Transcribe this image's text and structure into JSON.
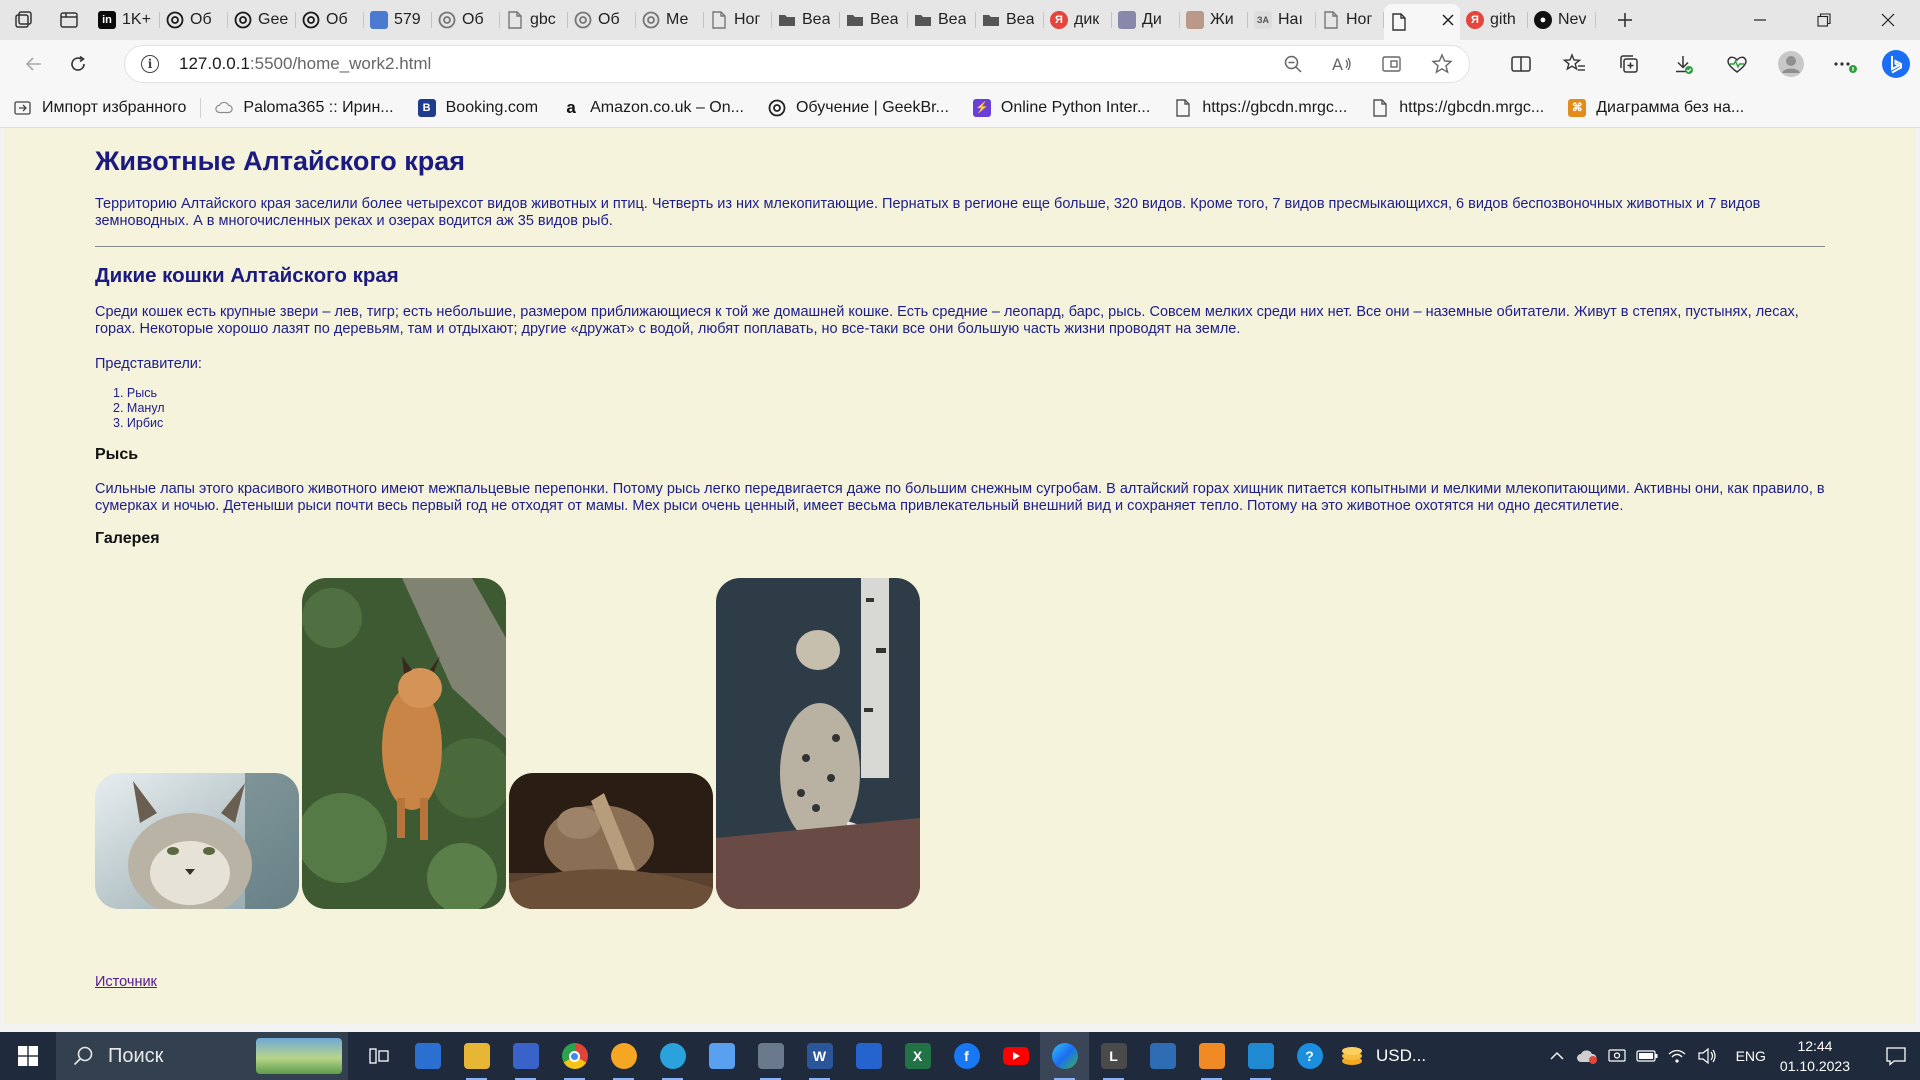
{
  "browser": {
    "tabs": [
      {
        "title": "1K+",
        "icon": "linkedin-icon",
        "color": "#0a0a0a"
      },
      {
        "title": "Об",
        "icon": "openai-icon",
        "color": "#1a1a1a"
      },
      {
        "title": "Gee",
        "icon": "openai-icon",
        "color": "#1a1a1a"
      },
      {
        "title": "Об",
        "icon": "openai-icon",
        "color": "#1a1a1a"
      },
      {
        "title": "579",
        "icon": "image-icon",
        "color": "#4b7bd1"
      },
      {
        "title": "Об",
        "icon": "openai-icon",
        "color": "#777777"
      },
      {
        "title": "gbc",
        "icon": "page-icon",
        "color": "#777777"
      },
      {
        "title": "Об",
        "icon": "openai-icon",
        "color": "#777777"
      },
      {
        "title": "Ме",
        "icon": "openai-icon",
        "color": "#777777"
      },
      {
        "title": "Ног",
        "icon": "page-icon",
        "color": "#777777"
      },
      {
        "title": "Веа",
        "icon": "folder-icon",
        "color": "#555555"
      },
      {
        "title": "Веа",
        "icon": "folder-icon",
        "color": "#555555"
      },
      {
        "title": "Веа",
        "icon": "folder-icon",
        "color": "#555555"
      },
      {
        "title": "Веа",
        "icon": "folder-icon",
        "color": "#555555"
      },
      {
        "title": "дик",
        "icon": "yandex-icon",
        "color": "#e5463b"
      },
      {
        "title": "Ди",
        "icon": "image-icon",
        "color": "#88a"
      },
      {
        "title": "Жи",
        "icon": "image-icon",
        "color": "#b98"
      },
      {
        "title": "Наı",
        "icon": "za-icon",
        "color": "#999999"
      },
      {
        "title": "Ног",
        "icon": "page-icon",
        "color": "#777777"
      },
      {
        "title": "",
        "icon": "page-icon",
        "color": "#333333",
        "active": true
      },
      {
        "title": "gith",
        "icon": "yandex-icon",
        "color": "#e5463b"
      },
      {
        "title": "Nev",
        "icon": "github-icon",
        "color": "#111111"
      }
    ],
    "url_host": "127.0.0.1",
    "url_path": ":5500/home_work2.html",
    "favorites": [
      {
        "label": "Импорт избранного",
        "icon": "import-icon",
        "color": "#444444"
      },
      {
        "label": "Paloma365 :: Ирин...",
        "icon": "cloud-icon",
        "color": "#888888"
      },
      {
        "label": "Booking.com",
        "icon": "booking-icon",
        "color": "#1f3b8c",
        "glyph": "B"
      },
      {
        "label": "Amazon.co.uk – On...",
        "icon": "amazon-icon",
        "color": "#111111",
        "glyph": "a"
      },
      {
        "label": "Обучение | GeekBr...",
        "icon": "openai-icon",
        "color": "#222222"
      },
      {
        "label": "Online Python Inter...",
        "icon": "bolt-icon",
        "color": "#6a3fd8",
        "glyph": "⚡"
      },
      {
        "label": "https://gbcdn.mrgc...",
        "icon": "page-icon",
        "color": "#555555"
      },
      {
        "label": "https://gbcdn.mrgc...",
        "icon": "page-icon",
        "color": "#555555"
      },
      {
        "label": "Диаграмма без на...",
        "icon": "diagram-icon",
        "color": "#e38b1b",
        "glyph": "⌘"
      }
    ]
  },
  "page": {
    "title": "Животные Алтайского края",
    "intro": "Территорию Алтайского края заселили более четырехсот видов животных и птиц. Четверть из них млекопитающие. Пернатых в регионе еще больше, 320 видов. Кроме того, 7 видов пресмыкающихся, 6 видов беспозвоночных животных и 7 видов земноводных. А в многочисленных реках и озерах водится аж 35 видов рыб.",
    "section_title": "Дикие кошки Алтайского края",
    "section_text": "Среди кошек есть крупные звери – лев, тигр; есть небольшие, размером приближающиеся к той же домашней кошке. Есть средние – леопард, барс, рысь. Совсем мелких среди них нет. Все они – наземные обитатели. Живут в степях, пустынях, лесах, горах. Некоторые хорошо лазят по деревьям, там и отдыхают; другие «дружат» с водой, любят поплавать, но все-таки все они большую часть жизни проводят на земле.",
    "representatives_label": "Представители:",
    "representatives": [
      "Рысь",
      "Манул",
      "Ирбис"
    ],
    "lynx_title": "Рысь",
    "lynx_text": "Сильные лапы этого красивого животного имеют межпальцевые перепонки. Потому рысь легко передвигается даже по большим снежным сугробам. В алтайский горах хищник питается копытными и мелкими млекопитающими. Активны они, как правило, в сумерках и ночью. Детеныши рыси почти весь первый год не отходят от мамы. Мех рыси очень ценный, имеет весьма привлекательный внешний вид и сохраняет тепло. Потому на это животное охотятся ни одно десятилетие.",
    "gallery_title": "Галерея",
    "gallery": [
      {
        "name": "lynx-portrait-photo"
      },
      {
        "name": "lynx-walking-photo"
      },
      {
        "name": "manul-photo"
      },
      {
        "name": "snow-leopard-photo"
      }
    ],
    "source_link": "Источник"
  },
  "taskbar": {
    "search_placeholder": "Поиск",
    "apps": [
      {
        "name": "task-view-icon",
        "color": "transparent"
      },
      {
        "name": "news-app-icon",
        "color": "#2b6fd1"
      },
      {
        "name": "file-explorer-icon",
        "color": "#e8b635"
      },
      {
        "name": "network-app-icon",
        "color": "#3a63c9"
      },
      {
        "name": "chrome-icon",
        "color": "#e0453a"
      },
      {
        "name": "yandex-browser-icon",
        "color": "#f5a623"
      },
      {
        "name": "telegram-icon",
        "color": "#2aa3dd"
      },
      {
        "name": "git-app-icon",
        "color": "#5aa0f0"
      },
      {
        "name": "calculator-icon",
        "color": "#6a7a8c"
      },
      {
        "name": "word-icon",
        "color": "#2b579a",
        "glyph": "W"
      },
      {
        "name": "todo-icon",
        "color": "#2564cf"
      },
      {
        "name": "excel-icon",
        "color": "#217346",
        "glyph": "X"
      },
      {
        "name": "facebook-icon",
        "color": "#1877f2",
        "glyph": "f"
      },
      {
        "name": "youtube-icon",
        "color": "#ff0000"
      },
      {
        "name": "edge-icon",
        "color": "#1b9de2"
      },
      {
        "name": "l-app-icon",
        "color": "#4a4a4a",
        "glyph": "L"
      },
      {
        "name": "virtualbox-icon",
        "color": "#2e6db4"
      },
      {
        "name": "sublime-icon",
        "color": "#f08a24"
      },
      {
        "name": "vscode-icon",
        "color": "#1f8ad2"
      },
      {
        "name": "help-icon",
        "color": "#1c8ee0",
        "glyph": "?"
      }
    ],
    "usd_label": "USD...",
    "lang": "ENG",
    "time": "12:44",
    "date": "01.10.2023"
  }
}
